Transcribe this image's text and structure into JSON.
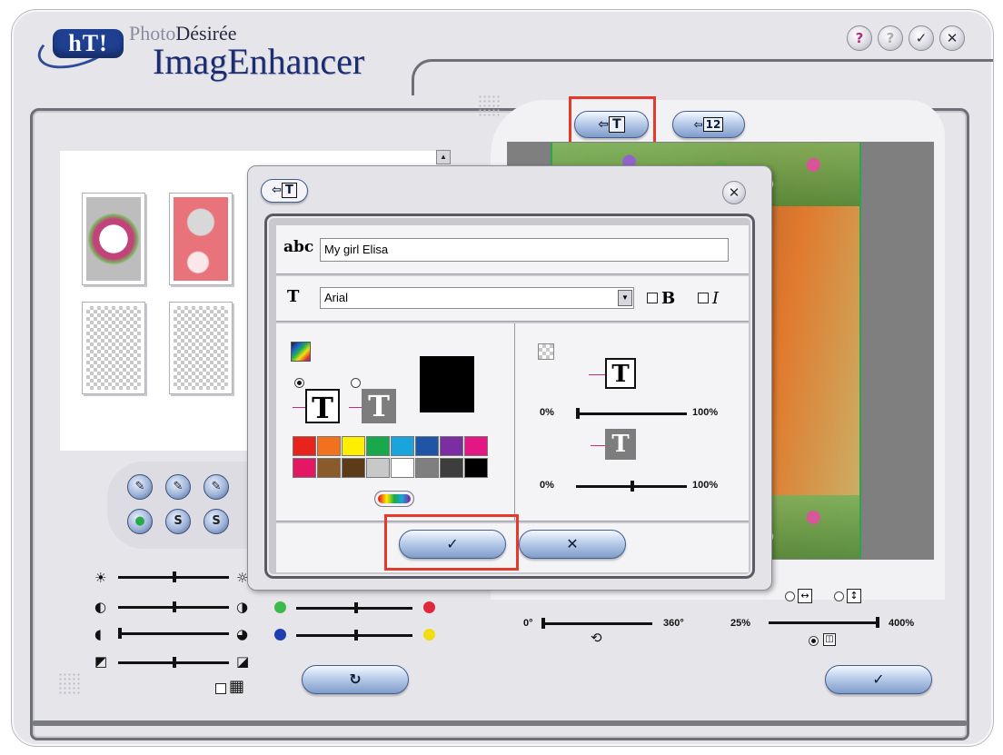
{
  "app": {
    "brand_line1_a": "Photo",
    "brand_line1_b": "Désirée",
    "brand_line2": "ImagEnhancer",
    "logo_text": "hT!",
    "window_buttons": [
      {
        "label": "?",
        "icon": "help-about-icon"
      },
      {
        "label": "?",
        "icon": "help-icon"
      },
      {
        "label": "✓",
        "icon": "ok-icon"
      },
      {
        "label": "✕",
        "icon": "close-icon"
      }
    ]
  },
  "templates": {
    "scroll_up": "▲"
  },
  "tools": {
    "row1": [
      "✎",
      "✎",
      "✎"
    ],
    "row2": [
      "●",
      "S",
      "S"
    ]
  },
  "adjust": {
    "check_grid_label": "▦",
    "rotate_button": "↻"
  },
  "preview": {
    "tab_text": "T",
    "tab_number": "12"
  },
  "transform": {
    "rotation_min": "0°",
    "rotation_max": "360°",
    "rotate_icon": "⟲",
    "zoom_min": "25%",
    "zoom_max": "400%",
    "fit_width_icon": "↔",
    "fit_height_icon": "↕",
    "fit_page_icon": "◫",
    "apply_label": "✓"
  },
  "text_dialog": {
    "title_icon": "T",
    "close_label": "✕",
    "text_label": "abc",
    "text_value": "My girl Elisa",
    "font_label": "T",
    "font_value": "Arial",
    "bold_label": "B",
    "italic_label": "I",
    "preview_T": "T",
    "opacity_min": "0%",
    "opacity_max": "100%",
    "opacity_min_2": "0%",
    "opacity_max_2": "100%",
    "ok_label": "✓",
    "cancel_label": "✕",
    "palette_row1": [
      "#e8231c",
      "#f2711e",
      "#ffee00",
      "#19a84b",
      "#19a5dc",
      "#1f55a5",
      "#7a2ea1",
      "#e31783"
    ],
    "palette_row2": [
      "#e31763",
      "#8b5a2b",
      "#5e3b18",
      "#c8c8c8",
      "#ffffff",
      "#7f7f7f",
      "#3d3d3d",
      "#000000"
    ],
    "selected_color": "#000000"
  },
  "colors": {
    "highlight": "#e5392c",
    "accent_blue": "#7f9bc9",
    "green_dot": "#3cba4a",
    "red_dot": "#e0283a",
    "blue_dot": "#1f3fb0",
    "yellow_dot": "#f2dd14"
  }
}
